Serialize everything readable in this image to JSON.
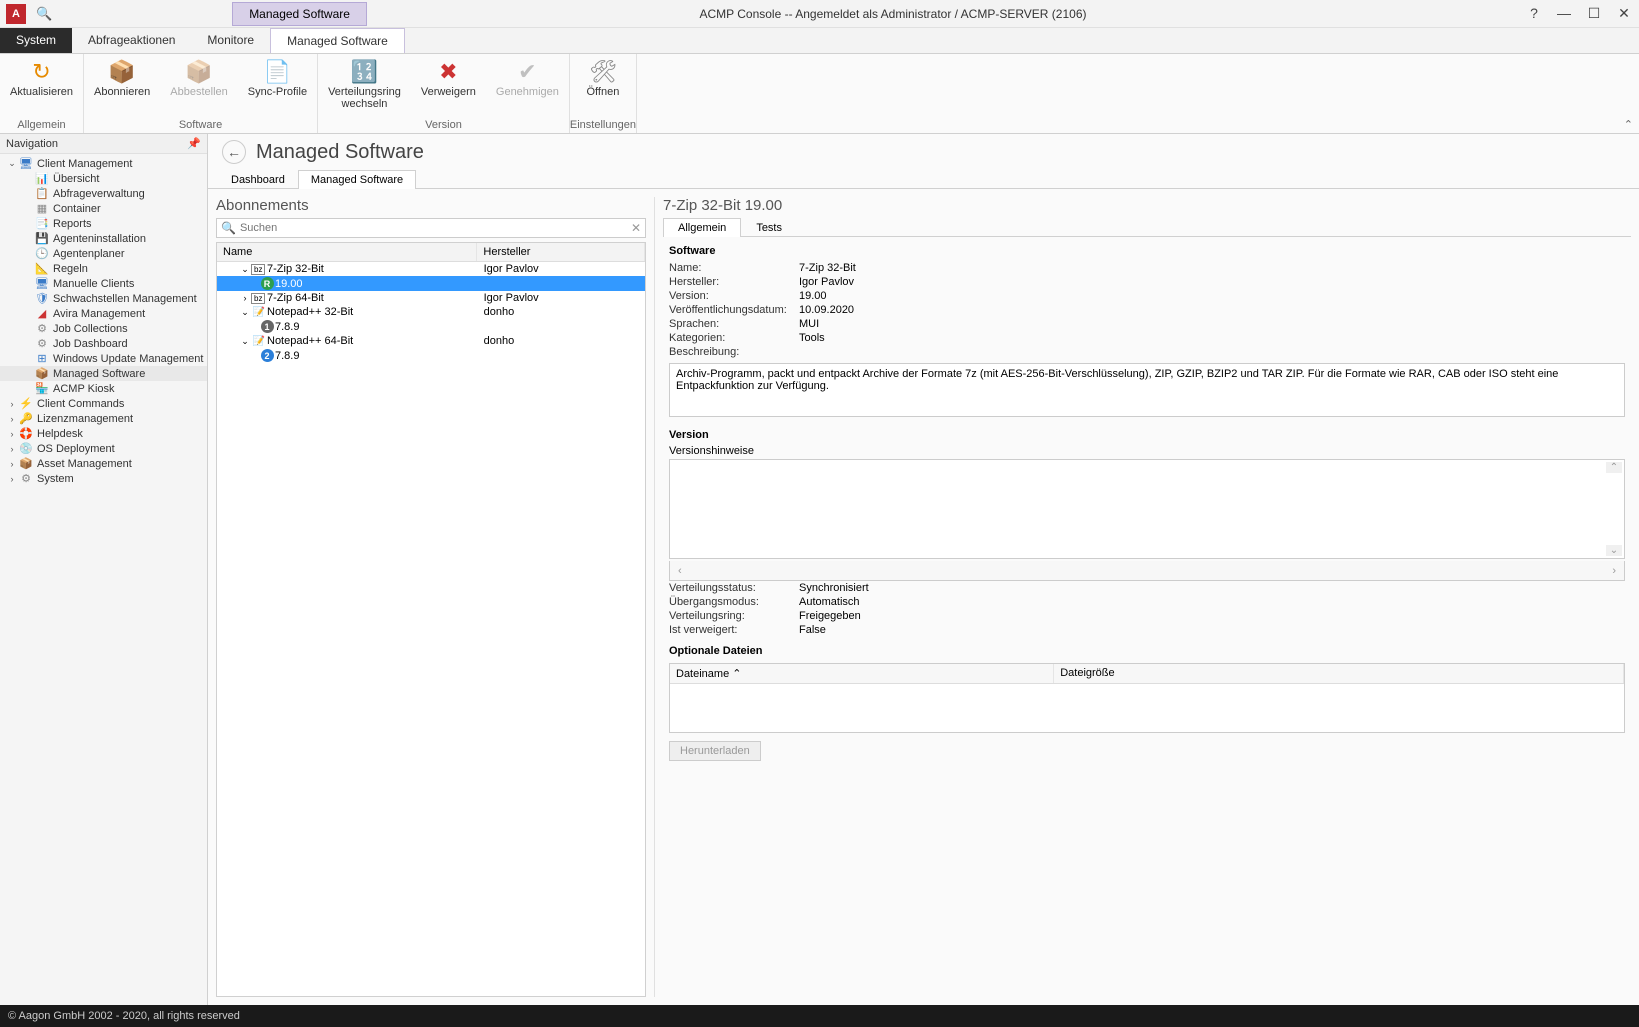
{
  "title": "ACMP Console -- Angemeldet als Administrator / ACMP-SERVER (2106)",
  "context_tab": "Managed Software",
  "menu_tabs": {
    "system": "System",
    "abfrage": "Abfrageaktionen",
    "monitore": "Monitore",
    "managed": "Managed Software"
  },
  "ribbon": {
    "aktualisieren": "Aktualisieren",
    "abonnieren": "Abonnieren",
    "abbestellen": "Abbestellen",
    "sync": "Sync-Profile",
    "verteilungsring": "Verteilungsring\nwechseln",
    "verweigern": "Verweigern",
    "genehmigen": "Genehmigen",
    "oeffnen": "Öffnen",
    "grp_allgemein": "Allgemein",
    "grp_software": "Software",
    "grp_version": "Version",
    "grp_einstellungen": "Einstellungen"
  },
  "nav": {
    "header": "Navigation",
    "items": {
      "client_mgmt": "Client Management",
      "uebersicht": "Übersicht",
      "abfrageverwaltung": "Abfrageverwaltung",
      "container": "Container",
      "reports": "Reports",
      "agenteninstallation": "Agenteninstallation",
      "agentenplaner": "Agentenplaner",
      "regeln": "Regeln",
      "manuelle_clients": "Manuelle Clients",
      "schwachstellen": "Schwachstellen Management",
      "avira": "Avira Management",
      "job_collections": "Job Collections",
      "job_dashboard": "Job Dashboard",
      "wum": "Windows Update Management",
      "managed_software": "Managed Software",
      "kiosk": "ACMP Kiosk",
      "client_commands": "Client Commands",
      "lizenz": "Lizenzmanagement",
      "helpdesk": "Helpdesk",
      "os_deploy": "OS Deployment",
      "asset": "Asset Management",
      "system": "System"
    }
  },
  "page": {
    "title": "Managed Software",
    "tabs": {
      "dashboard": "Dashboard",
      "managed": "Managed Software"
    }
  },
  "abon": {
    "title": "Abonnements",
    "search_placeholder": "Suchen",
    "col_name": "Name",
    "col_hersteller": "Hersteller",
    "rows": {
      "z32": {
        "name": "7-Zip 32-Bit",
        "vendor": "Igor Pavlov"
      },
      "z32v": {
        "name": "19.00"
      },
      "z64": {
        "name": "7-Zip 64-Bit",
        "vendor": "Igor Pavlov"
      },
      "np32": {
        "name": "Notepad++ 32-Bit",
        "vendor": "donho"
      },
      "np32v": {
        "name": "7.8.9"
      },
      "np64": {
        "name": "Notepad++ 64-Bit",
        "vendor": "donho"
      },
      "np64v": {
        "name": "7.8.9"
      }
    }
  },
  "detail": {
    "title": "7-Zip 32-Bit 19.00",
    "tabs": {
      "allgemein": "Allgemein",
      "tests": "Tests"
    },
    "sec_software": "Software",
    "k_name": "Name:",
    "v_name": "7-Zip 32-Bit",
    "k_hersteller": "Hersteller:",
    "v_hersteller": "Igor Pavlov",
    "k_version": "Version:",
    "v_version": "19.00",
    "k_verdatum": "Veröffentlichungsdatum:",
    "v_verdatum": "10.09.2020",
    "k_sprachen": "Sprachen:",
    "v_sprachen": "MUI",
    "k_kategorien": "Kategorien:",
    "v_kategorien": "Tools",
    "k_beschreibung": "Beschreibung:",
    "v_beschreibung": "Archiv-Programm, packt und entpackt Archive der Formate 7z (mit AES-256-Bit-Verschlüsselung), ZIP, GZIP, BZIP2 und TAR ZIP. Für die Formate wie RAR, CAB oder ISO steht eine Entpackfunktion zur Verfügung.",
    "sec_version": "Version",
    "versionshinweise": "Versionshinweise",
    "k_vstatus": "Verteilungsstatus:",
    "v_vstatus": "Synchronisiert",
    "k_uebergang": "Übergangsmodus:",
    "v_uebergang": "Automatisch",
    "k_vring": "Verteilungsring:",
    "v_vring": "Freigegeben",
    "k_verweigert": "Ist verweigert:",
    "v_verweigert": "False",
    "sec_optfiles": "Optionale Dateien",
    "col_dateiname": "Dateiname",
    "col_dateigroesse": "Dateigröße",
    "btn_download": "Herunterladen"
  },
  "footer": "© Aagon GmbH 2002 - 2020, all rights reserved"
}
